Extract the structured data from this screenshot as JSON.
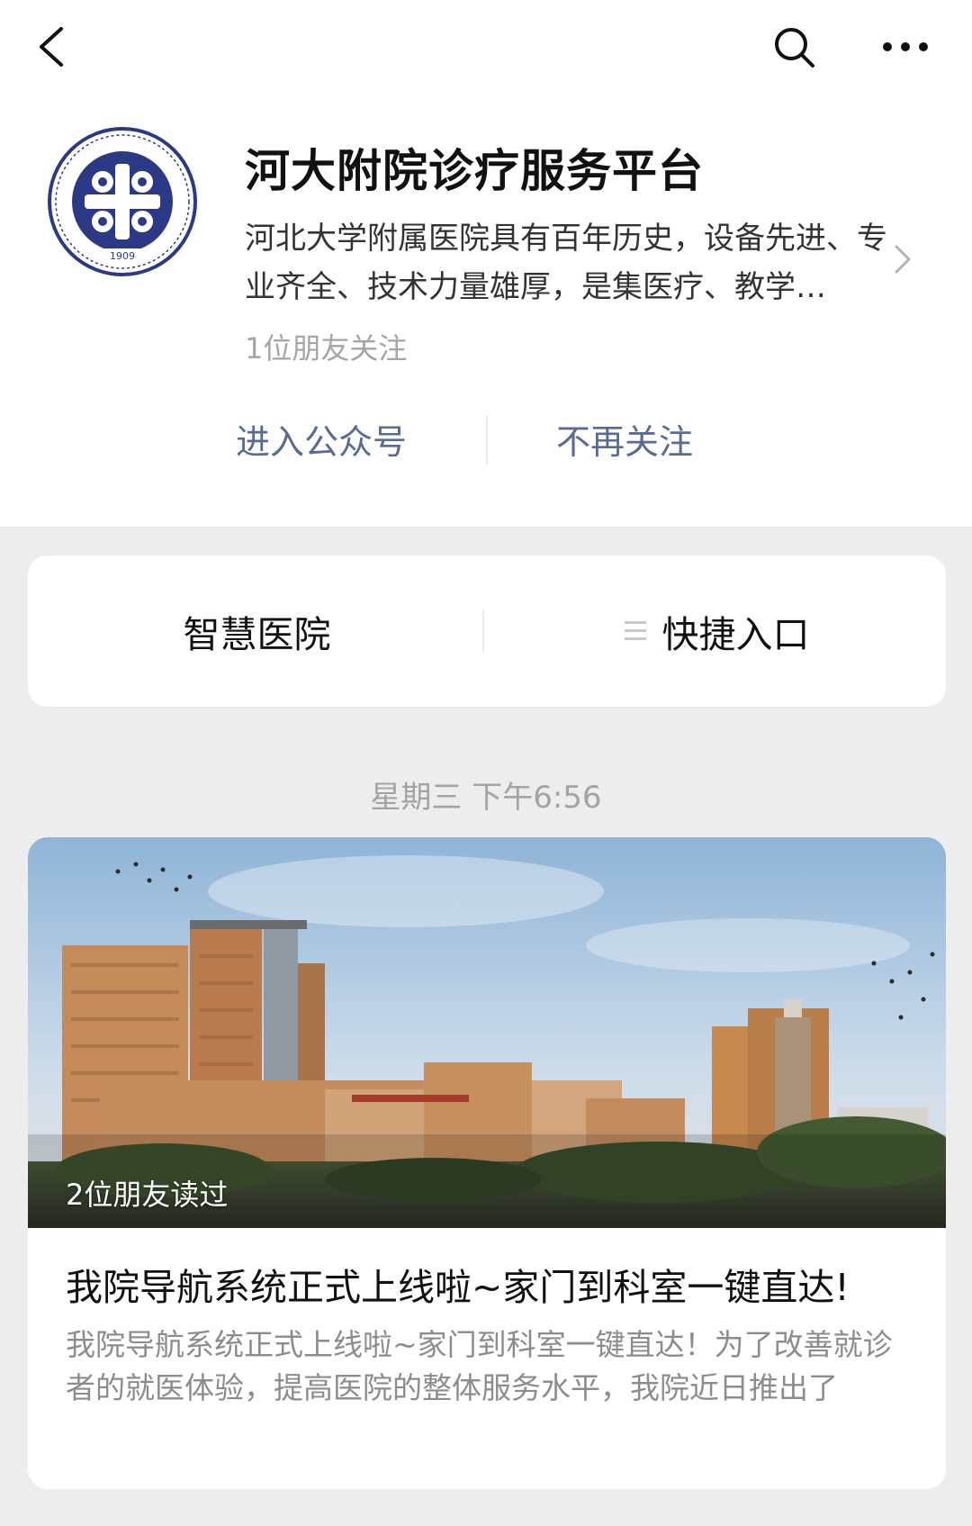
{
  "nav": {
    "back_icon": "chevron-left-icon",
    "search_icon": "search-icon",
    "more_icon": "more-dots-icon"
  },
  "account": {
    "logo_year": "1909",
    "name": "河大附院诊疗服务平台",
    "description": "河北大学附属医院具有百年历史，设备先进、专业齐全、技术力量雄厚，是集医疗、教学…",
    "friends_following": "1位朋友关注",
    "enter_label": "进入公众号",
    "unfollow_label": "不再关注"
  },
  "menu": {
    "items": [
      {
        "label": "智慧医院"
      },
      {
        "label": "快捷入口",
        "icon": "list-icon"
      }
    ]
  },
  "timestamp": "星期三 下午6:56",
  "article": {
    "read_by": "2位朋友读过",
    "title": "我院导航系统正式上线啦~家门到科室一键直达!",
    "digest": "我院导航系统正式上线啦~家门到科室一键直达！为了改善就诊者的就医体验，提高医院的整体服务水平，我院近日推出了"
  },
  "colors": {
    "link": "#576b95",
    "page_bg": "#ededed",
    "logo_blue": "#2c3a86"
  }
}
